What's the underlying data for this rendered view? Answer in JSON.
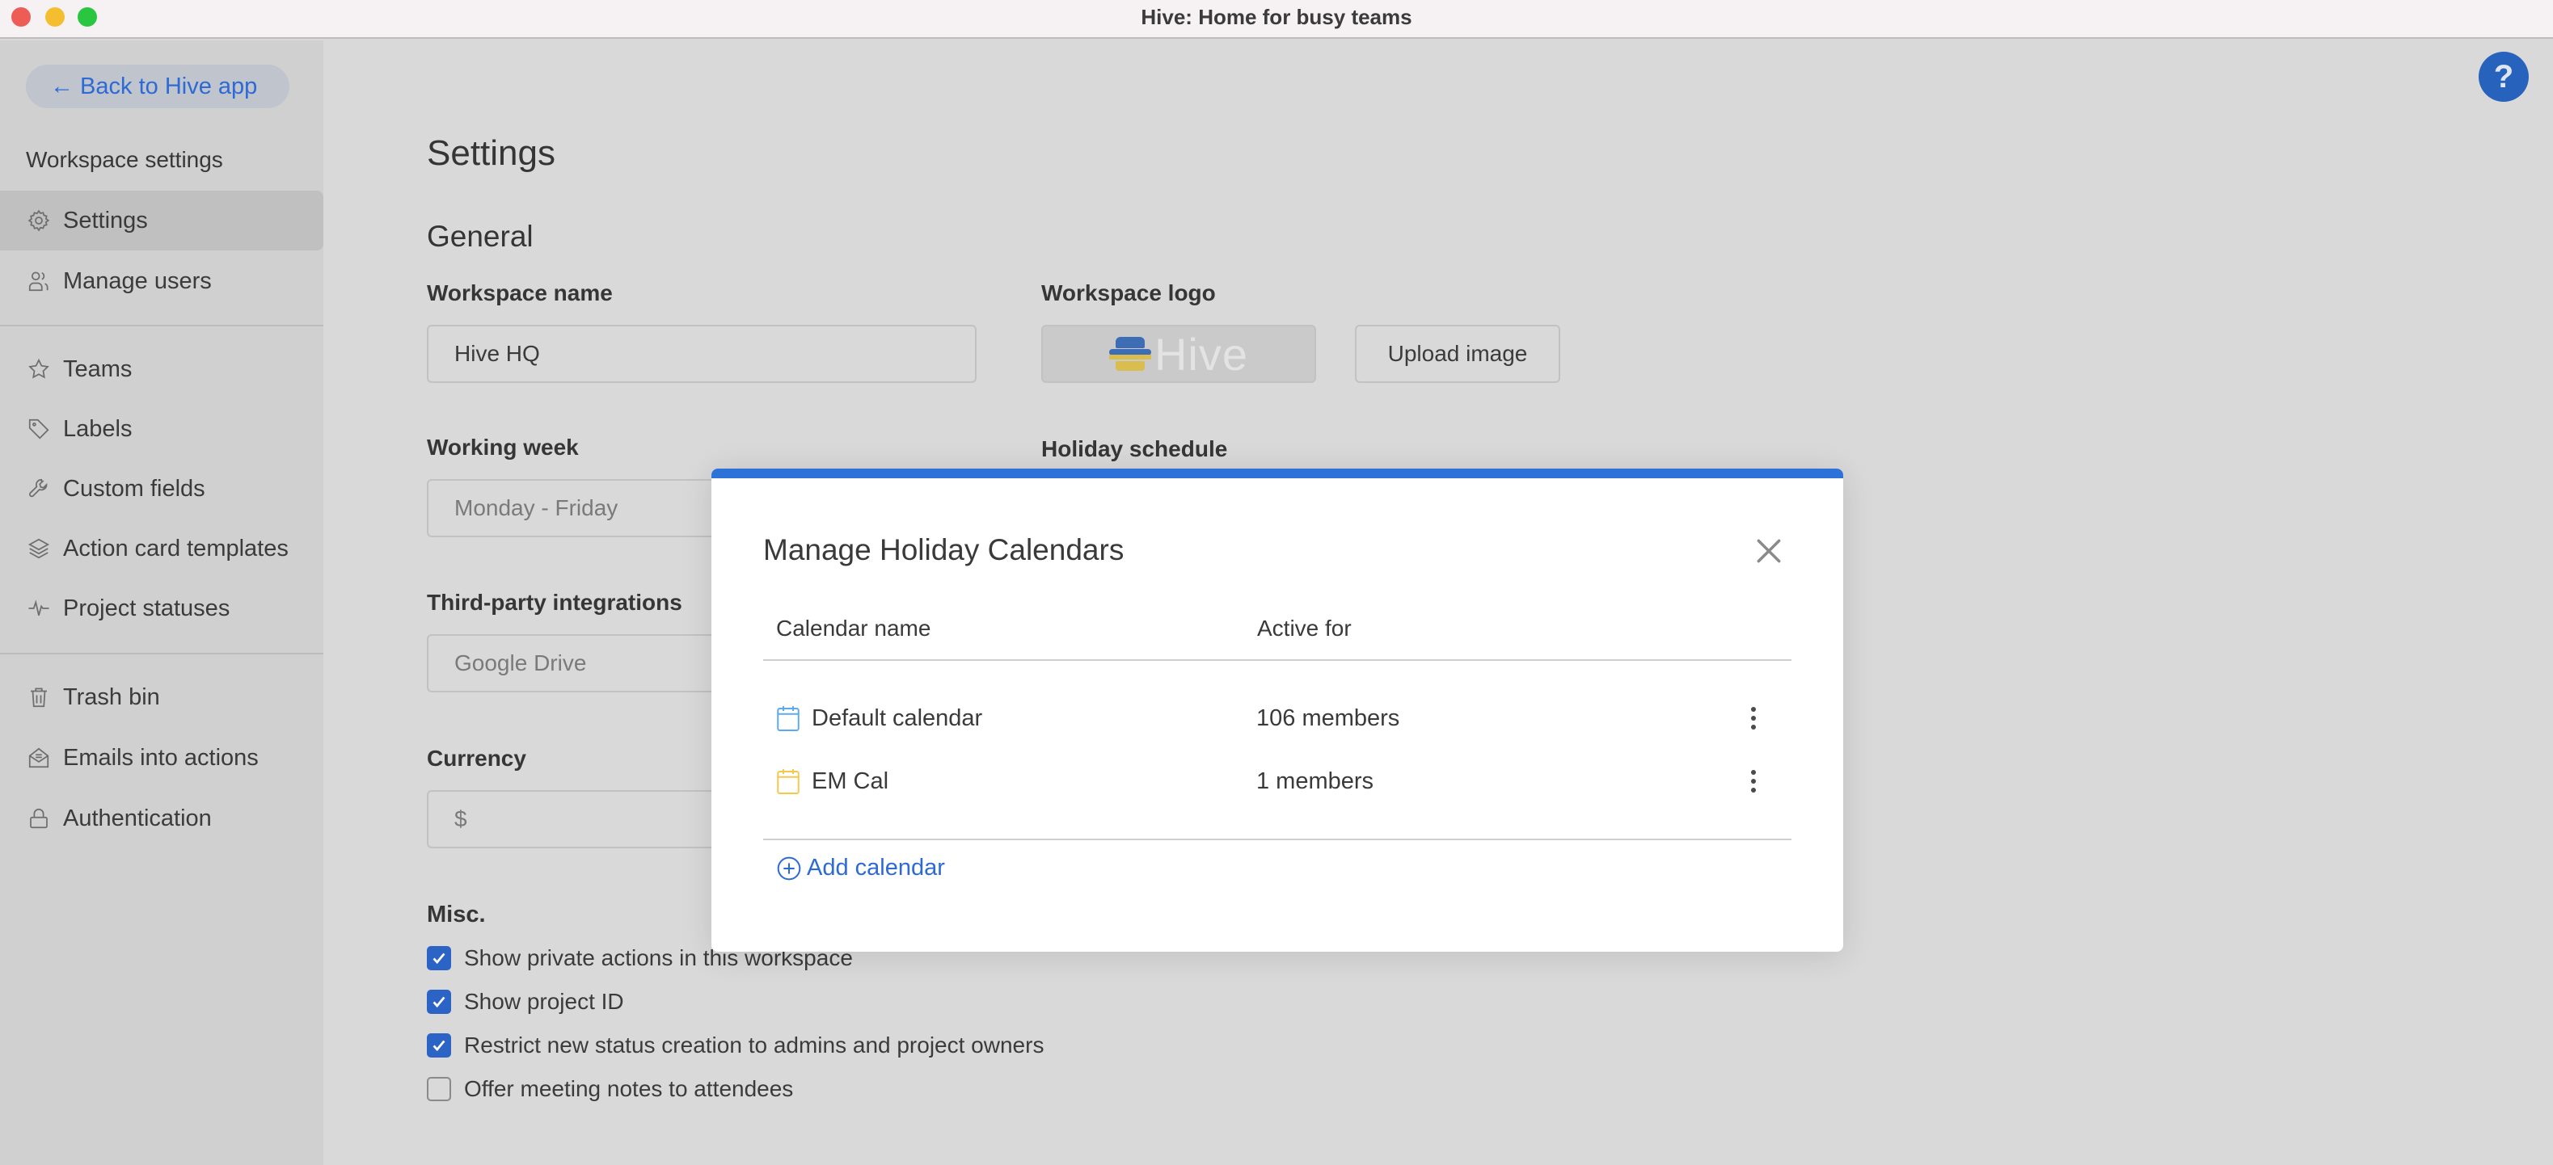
{
  "window": {
    "title": "Hive: Home for busy teams"
  },
  "sidebar": {
    "back_label": "← Back to Hive app",
    "heading": "Workspace settings",
    "items": [
      {
        "label": "Settings",
        "icon": "gear-icon",
        "active": true
      },
      {
        "label": "Manage users",
        "icon": "users-icon"
      },
      {
        "label": "Teams",
        "icon": "star-icon"
      },
      {
        "label": "Labels",
        "icon": "tag-icon"
      },
      {
        "label": "Custom fields",
        "icon": "wrench-icon"
      },
      {
        "label": "Action card templates",
        "icon": "layers-icon"
      },
      {
        "label": "Project statuses",
        "icon": "pulse-icon"
      },
      {
        "label": "Trash bin",
        "icon": "trash-icon"
      },
      {
        "label": "Emails into actions",
        "icon": "mail-icon"
      },
      {
        "label": "Authentication",
        "icon": "lock-icon"
      }
    ]
  },
  "main": {
    "title": "Settings",
    "section": "General",
    "workspace_name": {
      "label": "Workspace name",
      "value": "Hive HQ"
    },
    "workspace_logo": {
      "label": "Workspace logo",
      "logo_text": "Hive",
      "upload_label": "Upload image"
    },
    "working_week": {
      "label": "Working week",
      "value": "Monday - Friday"
    },
    "holiday_schedule": {
      "label": "Holiday schedule"
    },
    "integrations": {
      "label": "Third-party integrations",
      "value": "Google Drive"
    },
    "currency": {
      "label": "Currency",
      "value": "$"
    },
    "misc": {
      "title": "Misc.",
      "options": [
        {
          "label": "Show private actions in this workspace",
          "checked": true
        },
        {
          "label": "Show project ID",
          "checked": true
        },
        {
          "label": "Restrict new status creation to admins and project owners",
          "checked": true
        },
        {
          "label": "Offer meeting notes to attendees",
          "checked": false
        }
      ]
    },
    "help_label": "?"
  },
  "modal": {
    "title": "Manage Holiday Calendars",
    "columns": [
      "Calendar name",
      "Active for"
    ],
    "calendars": [
      {
        "name": "Default calendar",
        "active_for": "106 members",
        "color": "#5aaaf0"
      },
      {
        "name": "EM Cal",
        "active_for": "1 members",
        "color": "#f5c84a"
      }
    ],
    "add_label": "Add calendar",
    "accent_color": "#2d72d9"
  }
}
